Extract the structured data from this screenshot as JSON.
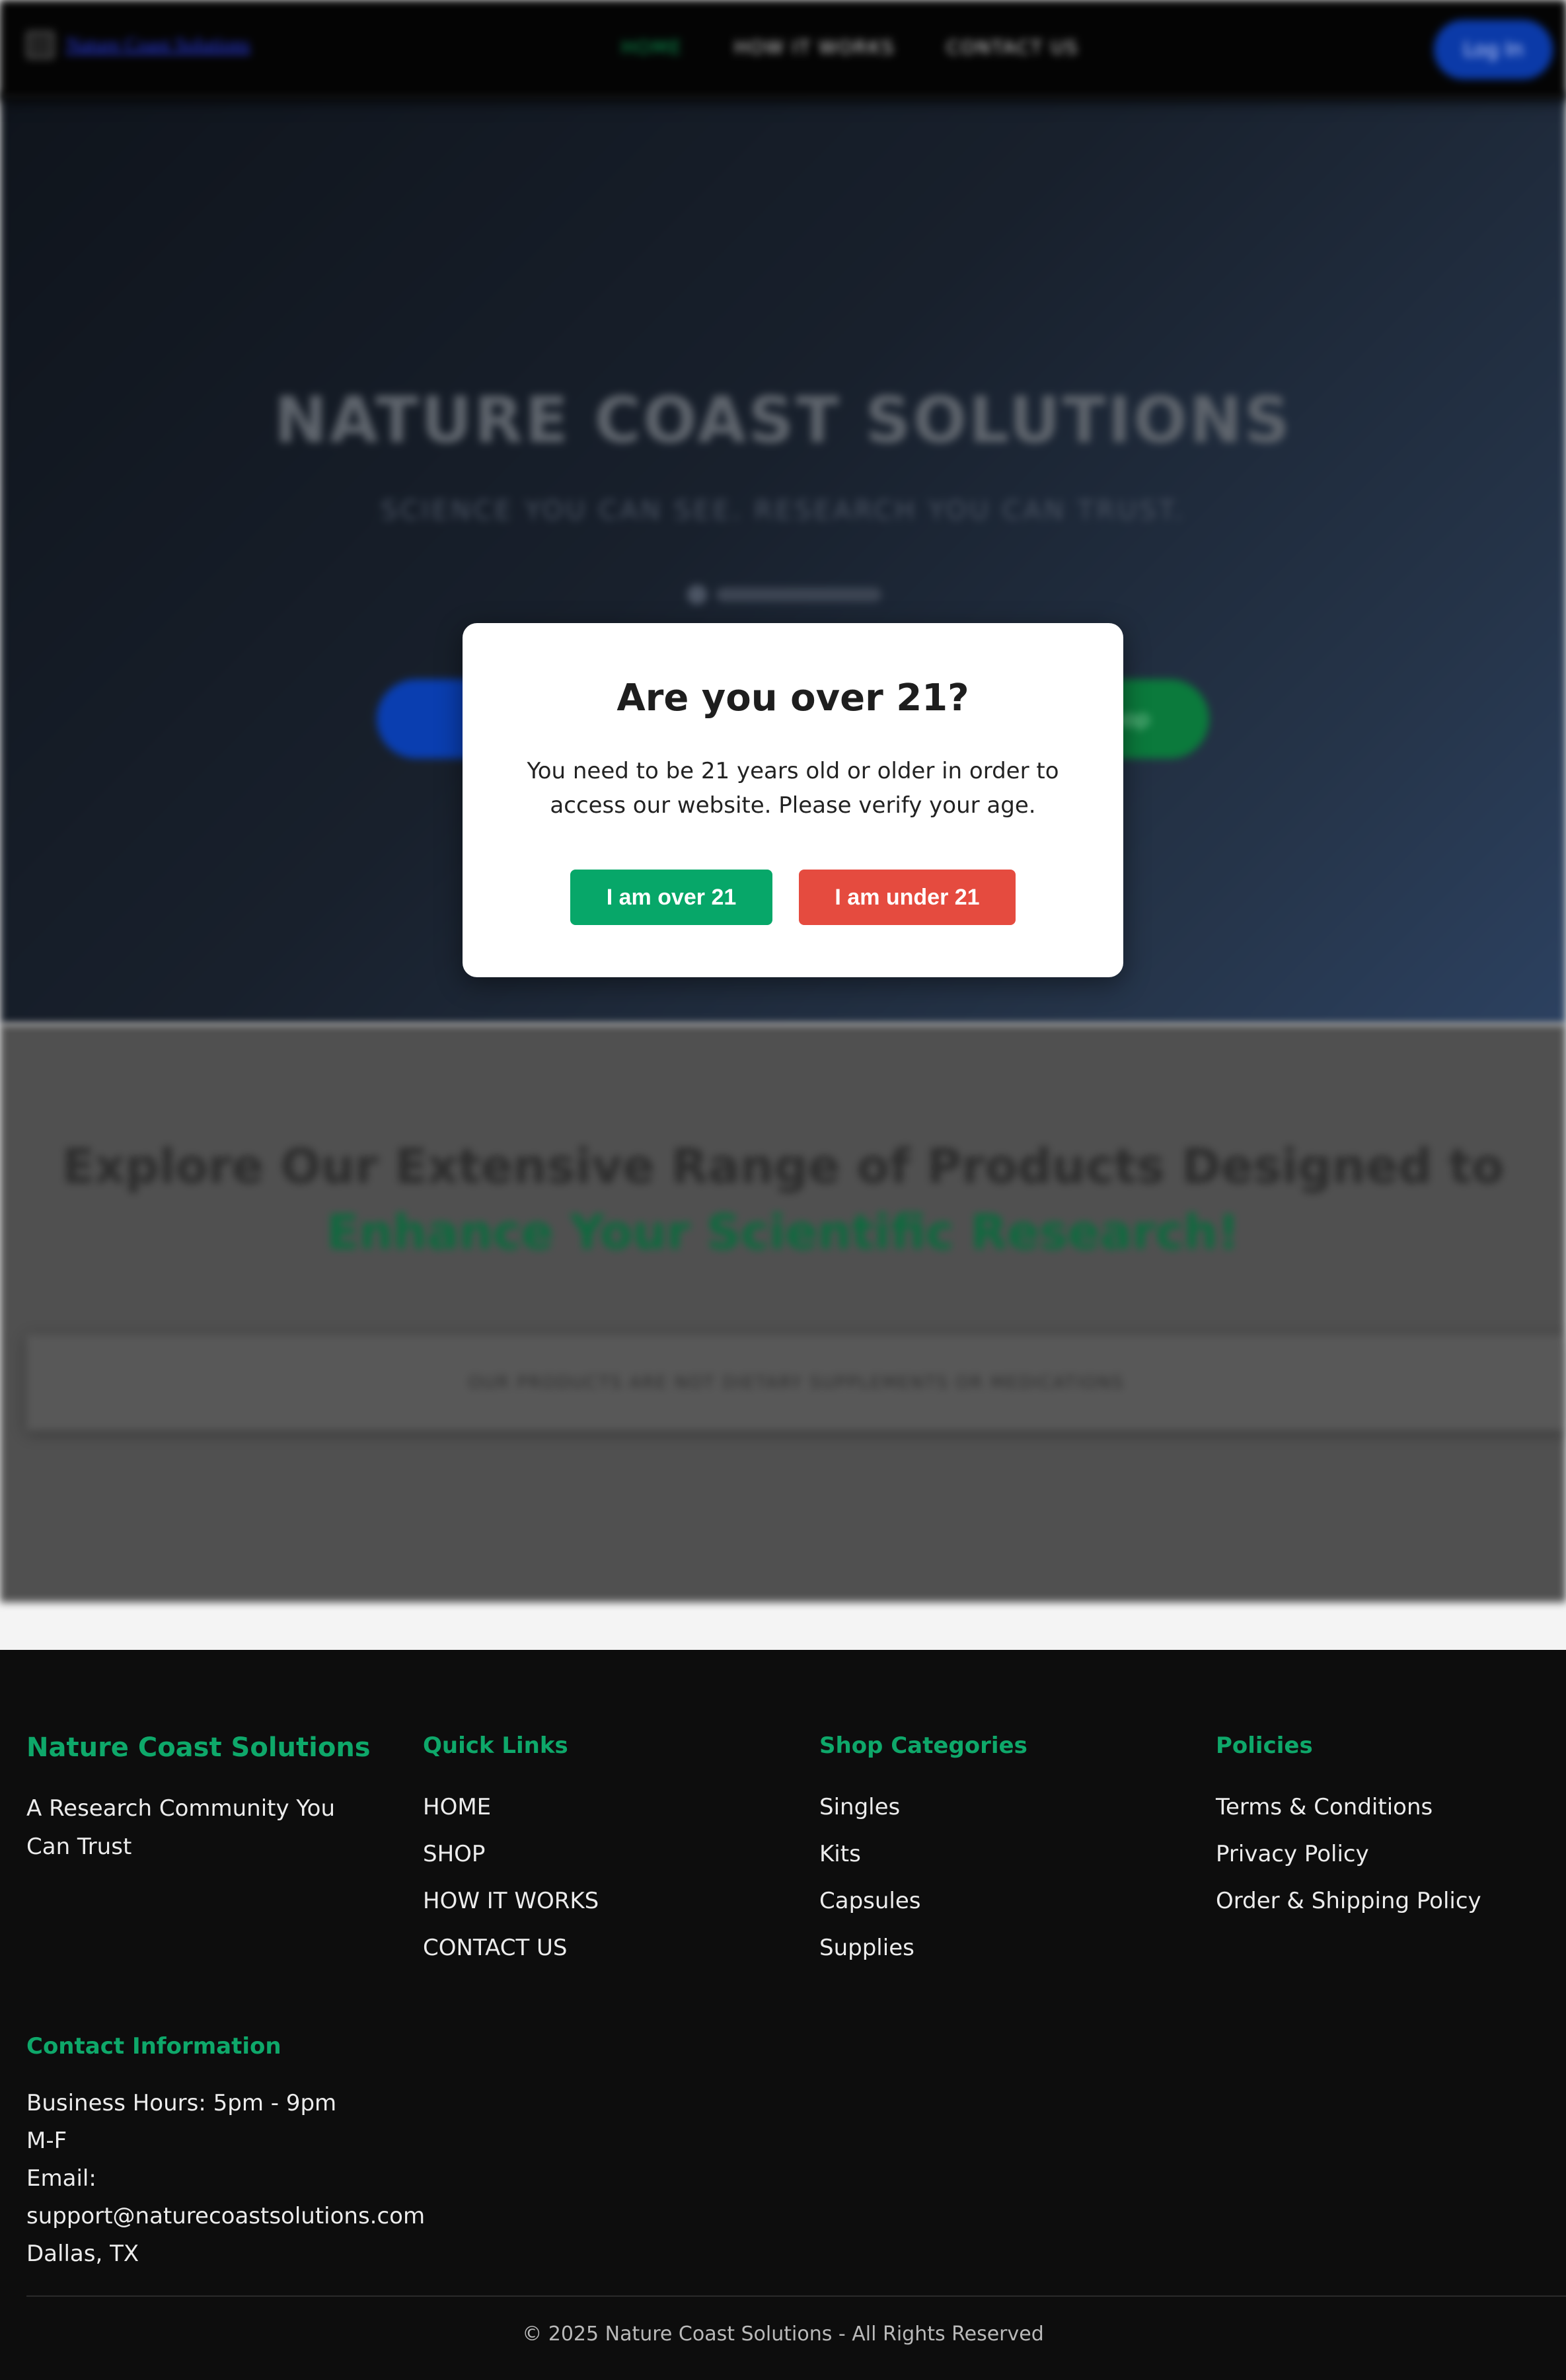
{
  "nav": {
    "logo_alt": "Nature Coast Solutions",
    "links": [
      "HOME",
      "HOW IT WORKS",
      "CONTACT US"
    ],
    "login_label": "Log In"
  },
  "hero": {
    "title": "NATURE COAST SOLUTIONS",
    "subtitle": "SCIENCE YOU CAN SEE. RESEARCH YOU CAN TRUST.",
    "btn_secondary": "Shop"
  },
  "products": {
    "heading_line1": "Explore Our Extensive Range of Products Designed to",
    "heading_line2": "Enhance Your Scientific Research!",
    "disclaimer": "OUR PRODUCTS ARE NOT DIETARY SUPPLEMENTS OR MEDICATIONS"
  },
  "modal": {
    "title": "Are you over 21?",
    "text": "You need to be 21 years old or older in order to access our website. Please verify your age.",
    "confirm_label": "I am over 21",
    "deny_label": "I am under 21"
  },
  "footer": {
    "brand": "Nature Coast Solutions",
    "tagline": "A Research Community You Can Trust",
    "quick_links": {
      "heading": "Quick Links",
      "items": [
        "HOME",
        "SHOP",
        "HOW IT WORKS",
        "CONTACT US"
      ]
    },
    "categories": {
      "heading": "Shop Categories",
      "items": [
        "Singles",
        "Kits",
        "Capsules",
        "Supplies"
      ]
    },
    "policies": {
      "heading": "Policies",
      "items": [
        "Terms & Conditions",
        "Privacy Policy",
        "Order & Shipping Policy"
      ]
    },
    "contact": {
      "heading": "Contact Information",
      "hours": "Business Hours: 5pm - 9pm M-F",
      "email_label": "Email:",
      "email": "support@naturecoastsolutions.com",
      "location": "Dallas, TX"
    },
    "copyright": "© 2025 Nature Coast Solutions - All Rights Reserved"
  },
  "colors": {
    "accent_green": "#0ea86a",
    "confirm_green": "#07a769",
    "deny_red": "#e54b3f"
  }
}
